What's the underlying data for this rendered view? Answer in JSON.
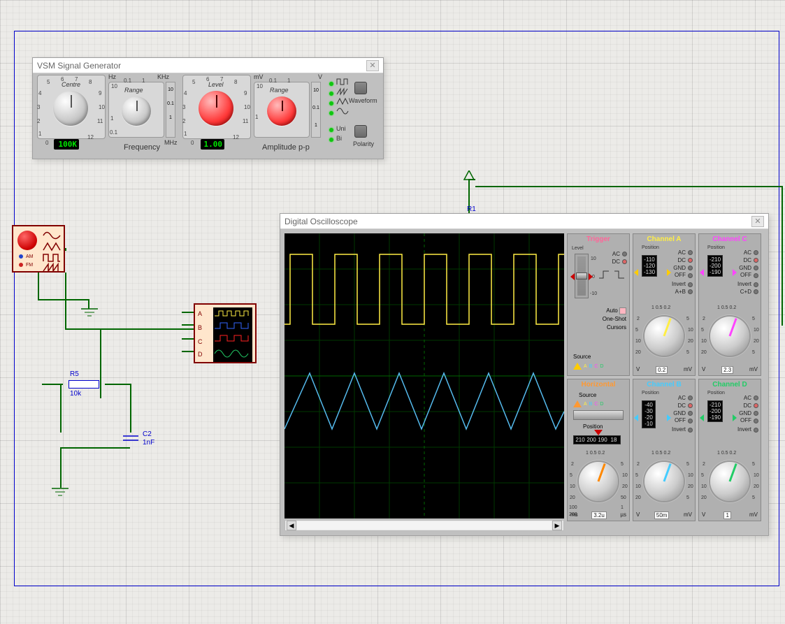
{
  "schematic": {
    "r1_label": "R1",
    "r5_label": "R5",
    "r5_value": "10k",
    "c2_label": "C2",
    "c2_value": "1nF",
    "am": "AM",
    "fm": "FM",
    "portA": "A",
    "portB": "B",
    "portC": "C",
    "portD": "D"
  },
  "siggen": {
    "title": "VSM Signal Generator",
    "centre_label": "Centre",
    "range_label": "Range",
    "level_label": "Level",
    "amp_range_label": "Range",
    "freq_section": "Frequency",
    "amp_section": "Amplitude p-p",
    "centre_value": "100K",
    "level_value": "1.00",
    "hz": "Hz",
    "khz": "KHz",
    "mhz": "MHz",
    "mv": "mV",
    "volt": "V",
    "uni": "Uni",
    "bi": "Bi",
    "waveform": "Waveform",
    "polarity": "Polarity",
    "ticks_small": {
      "t1": "1",
      "t2": "2",
      "t3": "3",
      "t4": "4",
      "t5": "5",
      "t6": "6",
      "t7": "7",
      "t8": "8",
      "t9": "9",
      "t10": "10",
      "t11": "11",
      "t12": "12",
      "t0": "0"
    },
    "range_ticks": {
      "a": "0.1",
      "b": "1",
      "c": "10",
      "d": "0.1",
      "e": "1"
    }
  },
  "osc": {
    "title": "Digital Oscilloscope",
    "trigger": {
      "title": "Trigger",
      "level": "Level",
      "lv10": "10",
      "lv0": "0",
      "lvn10": "-10",
      "ac": "AC",
      "dc": "DC",
      "auto": "Auto",
      "oneshot": "One-Shot",
      "cursors": "Cursors",
      "source": "Source",
      "a": "A",
      "b": "B",
      "c": "C",
      "d": "D"
    },
    "horizontal": {
      "title": "Horizontal",
      "source": "Source",
      "position": "Position",
      "a": "A",
      "b": "B",
      "c": "C",
      "d": "D",
      "pos_vals": {
        "p1": "210",
        "p2": "200",
        "p3": "190",
        "p4": "18"
      },
      "unit_left": "ms",
      "unit_right": "µs",
      "val": "3.2u",
      "scale": {
        "s1": "200",
        "s2": "100",
        "s3": "50",
        "s4": "20",
        "s5": "10",
        "s6": "5",
        "s7": "2",
        "s8": "1",
        "s9": "0.5"
      },
      "top": "1 0.5 0.2"
    },
    "chA": {
      "title": "Channel A",
      "position": "Position",
      "ac": "AC",
      "dc": "DC",
      "gnd": "GND",
      "off": "OFF",
      "inv": "Invert",
      "ab": "A+B",
      "pos_vals": {
        "p1": "-110",
        "p2": "-120",
        "p3": "-130"
      },
      "unit_left": "V",
      "unit_right": "mV",
      "val": "0.2",
      "scale": {
        "s1": "20",
        "s2": "10",
        "s3": "5",
        "s4": "2",
        "s5": "1",
        "s6": "20",
        "s7": "10",
        "s8": "5",
        "s9": "2"
      },
      "top": "1 0.5 0.2"
    },
    "chC": {
      "title": "Channel C",
      "position": "Position",
      "ac": "AC",
      "dc": "DC",
      "gnd": "GND",
      "off": "OFF",
      "inv": "Invert",
      "cd": "C+D",
      "pos_vals": {
        "p1": "-210",
        "p2": "-200",
        "p3": "-190"
      },
      "unit_left": "V",
      "unit_right": "mV",
      "val": "2.3",
      "scale": {
        "s1": "20",
        "s2": "10",
        "s3": "5",
        "s4": "2",
        "s5": "1",
        "s6": "20",
        "s7": "10",
        "s8": "5",
        "s9": "2"
      },
      "top": "1 0.5 0.2"
    },
    "chB": {
      "title": "Channel B",
      "position": "Position",
      "ac": "AC",
      "dc": "DC",
      "gnd": "GND",
      "off": "OFF",
      "inv": "Invert",
      "pos_vals": {
        "p1": "-40",
        "p2": "-30",
        "p3": "-20",
        "p4": "-10"
      },
      "unit_left": "V",
      "unit_right": "mV",
      "val": "50m",
      "scale": {
        "s1": "20",
        "s2": "10",
        "s3": "5",
        "s4": "2",
        "s5": "1",
        "s6": "20",
        "s7": "10",
        "s8": "5",
        "s9": "2"
      },
      "top": "1 0.5 0.2"
    },
    "chD": {
      "title": "Channel D",
      "position": "Position",
      "ac": "AC",
      "dc": "DC",
      "gnd": "GND",
      "off": "OFF",
      "inv": "Invert",
      "pos_vals": {
        "p1": "-210",
        "p2": "-200",
        "p3": "-190"
      },
      "unit_left": "V",
      "unit_right": "mV",
      "val": "1",
      "scale": {
        "s1": "20",
        "s2": "10",
        "s3": "5",
        "s4": "2",
        "s5": "1",
        "s6": "20",
        "s7": "10",
        "s8": "5",
        "s9": "2"
      },
      "top": "1 0.5 0.2"
    }
  }
}
